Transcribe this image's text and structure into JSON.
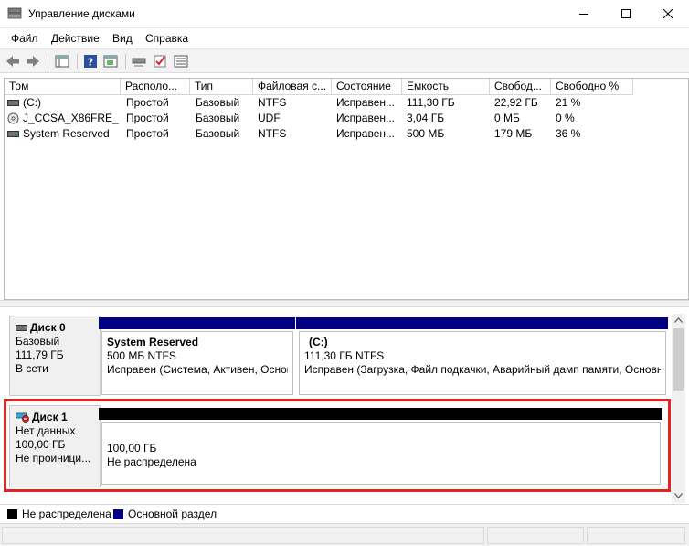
{
  "window": {
    "title": "Управление дисками",
    "icons": [
      "app-icon",
      "minimize-icon",
      "maximize-icon",
      "close-icon"
    ]
  },
  "menu": [
    "Файл",
    "Действие",
    "Вид",
    "Справка"
  ],
  "toolbar": {
    "icons": [
      "back-icon",
      "forward-icon",
      "console-tree-icon",
      "help-icon",
      "properties-icon",
      "connect-disk-icon",
      "check-icon",
      "list-view-icon"
    ]
  },
  "volume_list": {
    "columns": [
      "Том",
      "Располо...",
      "Тип",
      "Файловая с...",
      "Состояние",
      "Емкость",
      "Свобод...",
      "Свободно %"
    ],
    "rows": [
      {
        "icon": "volume-icon",
        "cells": [
          "(C:)",
          "Простой",
          "Базовый",
          "NTFS",
          "Исправен...",
          "111,30 ГБ",
          "22,92 ГБ",
          "21 %"
        ]
      },
      {
        "icon": "cd-icon",
        "cells": [
          "J_CCSA_X86FRE_R...",
          "Простой",
          "Базовый",
          "UDF",
          "Исправен...",
          "3,04 ГБ",
          "0 МБ",
          "0 %"
        ]
      },
      {
        "icon": "volume-icon",
        "cells": [
          "System Reserved",
          "Простой",
          "Базовый",
          "NTFS",
          "Исправен...",
          "500 МБ",
          "179 МБ",
          "36 %"
        ]
      }
    ]
  },
  "disks": [
    {
      "name": "Диск 0",
      "icon": "disk-icon",
      "lines": [
        "Базовый",
        "111,79 ГБ",
        "В сети"
      ],
      "partitions": [
        {
          "title": "System Reserved",
          "lines": [
            "500 МБ NTFS",
            "Исправен (Система, Активен, Основ"
          ],
          "color": "#000080"
        },
        {
          "title": "(C:)",
          "lines": [
            "111,30 ГБ NTFS",
            "Исправен (Загрузка, Файл подкачки, Аварийный дамп памяти, Основн"
          ],
          "color": "#000080"
        }
      ]
    },
    {
      "name": "Диск 1",
      "icon": "disk-uninitialized-icon",
      "lines": [
        "Нет данных",
        "100,00 ГБ",
        "Не проиници..."
      ],
      "partitions": [
        {
          "title": "",
          "lines": [
            "100,00 ГБ",
            "Не распределена"
          ],
          "color": "#000000"
        }
      ]
    }
  ],
  "legend": [
    {
      "label": "Не распределена",
      "color": "#000000"
    },
    {
      "label": "Основной раздел",
      "color": "#000080"
    }
  ],
  "colors": {
    "highlight": "#e02323",
    "primary": "#000080",
    "unallocated": "#000000"
  }
}
